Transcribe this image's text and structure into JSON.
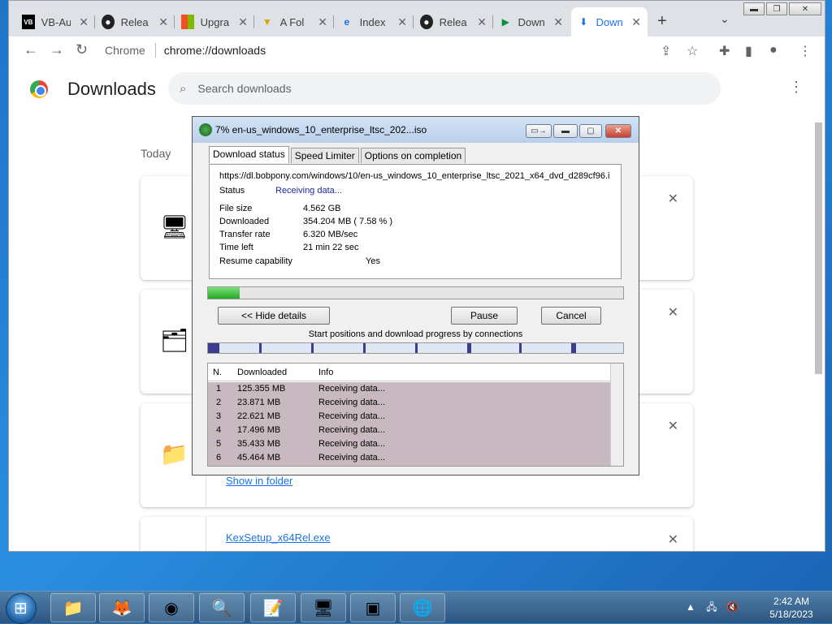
{
  "browser": {
    "tabs": [
      {
        "label": "VB-Au",
        "icon": "vb-icon"
      },
      {
        "label": "Relea",
        "icon": "github-icon"
      },
      {
        "label": "Upgra",
        "icon": "windows-icon"
      },
      {
        "label": "A Fol",
        "icon": "folder-icon"
      },
      {
        "label": "Index",
        "icon": "ie-icon"
      },
      {
        "label": "Relea",
        "icon": "github-icon"
      },
      {
        "label": "Down",
        "icon": "play-icon"
      },
      {
        "label": "Down",
        "icon": "download-icon"
      }
    ],
    "omnibox": {
      "origin": "Chrome",
      "url": "chrome://downloads"
    }
  },
  "downloads_page": {
    "title": "Downloads",
    "search_placeholder": "Search downloads",
    "group_label": "Today",
    "cards": [
      {
        "icon": "installer-icon",
        "link": ""
      },
      {
        "icon": "archive-icon",
        "link": ""
      },
      {
        "icon": "zip-folder-icon",
        "link": "Show in folder"
      },
      {
        "icon": "exe-icon",
        "link": "KexSetup_x64Rel.exe"
      }
    ]
  },
  "idm": {
    "title": "7% en-us_windows_10_enterprise_ltsc_202...iso",
    "tabs": [
      "Download status",
      "Speed Limiter",
      "Options on completion"
    ],
    "url": "https://dl.bobpony.com/windows/10/en-us_windows_10_enterprise_ltsc_2021_x64_dvd_d289cf96.i",
    "status_label": "Status",
    "status_value": "Receiving data...",
    "file_size_label": "File size",
    "file_size": "4.562  GB",
    "downloaded_label": "Downloaded",
    "downloaded": "354.204  MB  ( 7.58 % )",
    "transfer_rate_label": "Transfer rate",
    "transfer_rate": "6.320  MB/sec",
    "time_left_label": "Time left",
    "time_left": "21 min 22 sec",
    "resume_label": "Resume capability",
    "resume_value": "Yes",
    "progress_percent": 7.58,
    "buttons": {
      "hide": "<< Hide details",
      "pause": "Pause",
      "cancel": "Cancel"
    },
    "connections_label": "Start positions and download progress by connections",
    "connections_table": {
      "headers": [
        "N.",
        "Downloaded",
        "Info"
      ],
      "rows": [
        {
          "n": "1",
          "downloaded": "125.355  MB",
          "info": "Receiving data..."
        },
        {
          "n": "2",
          "downloaded": "23.871  MB",
          "info": "Receiving data..."
        },
        {
          "n": "3",
          "downloaded": "22.621  MB",
          "info": "Receiving data..."
        },
        {
          "n": "4",
          "downloaded": "17.496  MB",
          "info": "Receiving data..."
        },
        {
          "n": "5",
          "downloaded": "35.433  MB",
          "info": "Receiving data..."
        },
        {
          "n": "6",
          "downloaded": "45.464  MB",
          "info": "Receiving data..."
        }
      ]
    }
  },
  "taskbar": {
    "apps": [
      "explorer-icon",
      "firefox-icon",
      "chrome-icon",
      "search-tool-icon",
      "notepad-icon",
      "control-panel-icon",
      "cmd-icon",
      "idm-icon"
    ],
    "time": "2:42 AM",
    "date": "5/18/2023"
  }
}
